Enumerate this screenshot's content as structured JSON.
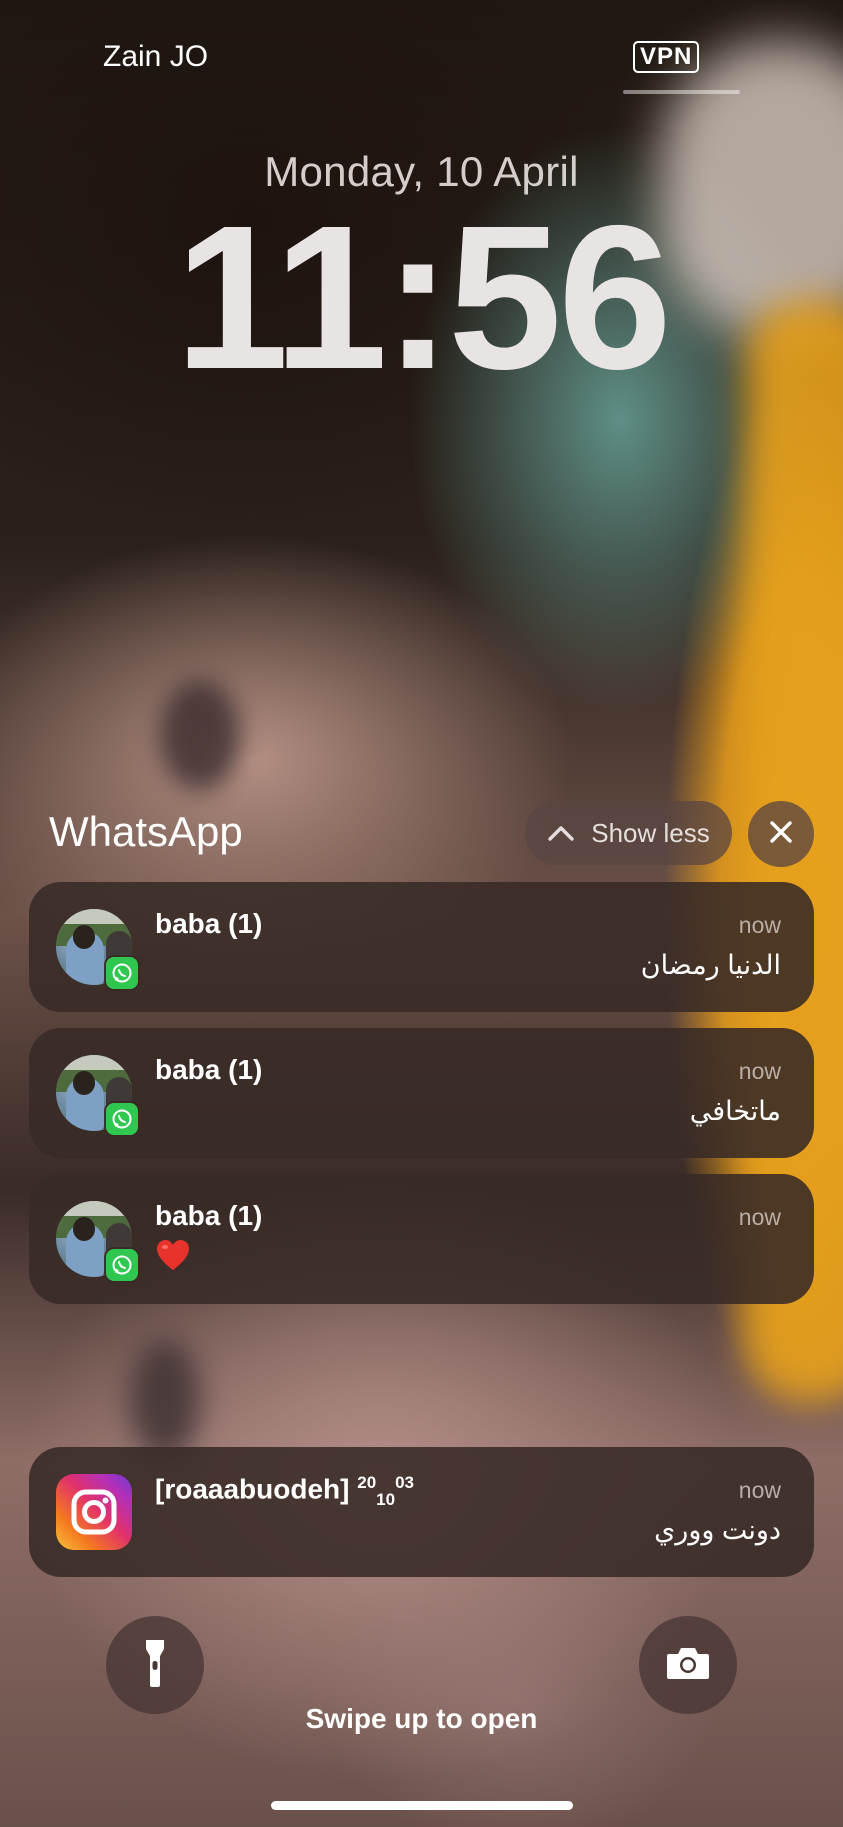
{
  "status_bar": {
    "carrier": "Zain JO",
    "vpn": "VPN"
  },
  "lock_screen": {
    "date": "Monday, 10 April",
    "time": "11:56"
  },
  "notification_group": {
    "app": "WhatsApp",
    "show_less_label": "Show less",
    "items": [
      {
        "sender": "baba (1)",
        "time": "now",
        "message": "الدنيا رمضان"
      },
      {
        "sender": "baba (1)",
        "time": "now",
        "message": "ماتخافي"
      },
      {
        "sender": "baba (1)",
        "time": "now",
        "message": "❤️",
        "icon": "heart-emoji"
      }
    ]
  },
  "instagram_notification": {
    "sender_main": "[roaaabuodeh] ",
    "sender_sup1": "20",
    "sender_sub": "10",
    "sender_sup2": "03",
    "time": "now",
    "message": "دونت ووري"
  },
  "bottom": {
    "left_button_icon": "flashlight-icon",
    "right_button_icon": "camera-icon",
    "swipe_hint": "Swipe up to open"
  },
  "colors": {
    "whatsapp_green": "#2fc74f",
    "card_bg": "#382a26"
  }
}
